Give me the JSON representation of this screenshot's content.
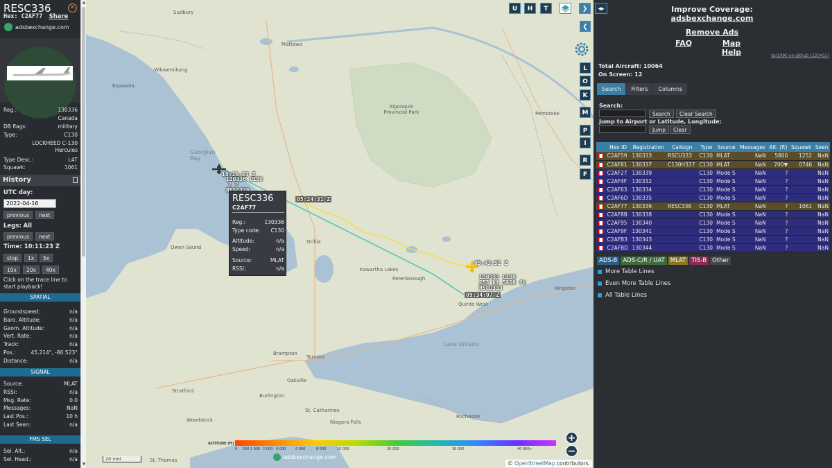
{
  "left": {
    "title": "RESC336",
    "hex_label": "Hex:",
    "hex_value": "C2AF77",
    "share": "Share",
    "logo_text": "adsbexchange.com",
    "reg_label": "Reg.:",
    "reg_value": "130336",
    "country": "Canada",
    "dbflags_label": "DB flags:",
    "dbflags_value": "military",
    "type_label": "Type:",
    "type_value": "C130",
    "type_desc_full": "LOCKHEED C-130",
    "type_desc_full2": "Hercules",
    "typedesc_label": "Type Desc.:",
    "typedesc_value": "L4T",
    "squawk_label": "Squawk:",
    "squawk_value": "1061",
    "history_label": "History",
    "utc_label": "UTC day:",
    "utc_value": "2022-04-16",
    "previous": "previous",
    "next": "next",
    "legs_label": "Legs: All",
    "time_label": "Time: 10:11:23 Z",
    "stop": "stop",
    "x1": "1x",
    "x5": "5x",
    "x10": "10x",
    "x20": "20x",
    "x40": "40x",
    "help_text": "Click on the trace line to start playback!",
    "spatial_label": "SPATIAL",
    "spatial": [
      {
        "k": "Groundspeed:",
        "v": "n/a"
      },
      {
        "k": "Baro. Altitude:",
        "v": "n/a"
      },
      {
        "k": "Geom. Altitude:",
        "v": "n/a"
      },
      {
        "k": "Vert. Rate:",
        "v": "n/a"
      },
      {
        "k": "Track:",
        "v": "n/a"
      },
      {
        "k": "Pos.:",
        "v": "45.214°, -80.523°"
      },
      {
        "k": "Distance:",
        "v": "n/a"
      }
    ],
    "signal_label": "SIGNAL",
    "signal": [
      {
        "k": "Source:",
        "v": "MLAT"
      },
      {
        "k": "RSSI:",
        "v": "n/a"
      },
      {
        "k": "Msg. Rate:",
        "v": "0.0"
      },
      {
        "k": "Messages:",
        "v": "NaN"
      },
      {
        "k": "Last Pos.:",
        "v": "10 h"
      },
      {
        "k": "Last Seen:",
        "v": "n/a"
      }
    ],
    "fms_label": "FMS SEL",
    "fms": [
      {
        "k": "Sel. Alt.:",
        "v": "n/a"
      },
      {
        "k": "Sel. Head.:",
        "v": "n/a"
      }
    ]
  },
  "map": {
    "top_buttons": [
      "U",
      "H",
      "T"
    ],
    "side_buttons": [
      "L",
      "O",
      "K",
      "M",
      "P",
      "I",
      "R",
      "F"
    ],
    "labels": {
      "sudbury": "Sudbury",
      "mattawa": "Mattawa",
      "algonquin": "Algonquin Provincial Park",
      "georgian": "Georgian Bay",
      "pembroke": "Pembroke",
      "owen": "Owen Sound",
      "orillia": "Orillia",
      "kawartha": "Kawartha Lakes",
      "peterborough": "Peterborough",
      "kingston": "Kingston",
      "quinte": "Quinte West",
      "ontario": "Lake Ontario",
      "brampton": "Brampton",
      "toronto": "Toronto",
      "oakville": "Oakville",
      "burlington": "Burlington",
      "stratford": "Stratford",
      "woodstock": "Woodstock",
      "stcath": "St. Catharines",
      "niagara": "Niagara Falls",
      "rochester": "Rochester",
      "stthomas": "St. Thomas",
      "espanola": "Espanola",
      "wawa": "Wikwemikong"
    },
    "trace": {
      "start_time": "10:11:23 Z",
      "start_info1": "130336 C130",
      "start_info2": "?     ?",
      "start_info3": "RESC336",
      "mid_time": "05:24:31 Z",
      "end_time1": "05:43:52 Z",
      "end_info1": "130333 C130",
      "end_info2": "253 kt  5800 ft",
      "end_info3": "RSCU333",
      "end_time2": "09:34:07 Z"
    },
    "popup": {
      "title": "RESC336",
      "hex": "C2AF77",
      "rows": [
        {
          "k": "Reg.:",
          "v": "130336"
        },
        {
          "k": "Type code:",
          "v": "C130"
        },
        {
          "k": "Altitude:",
          "v": "n/a"
        },
        {
          "k": "Speed:",
          "v": "n/a"
        },
        {
          "k": "Source:",
          "v": "MLAT"
        },
        {
          "k": "RSSI:",
          "v": "n/a"
        }
      ]
    },
    "legend_title": "ALTITUDE (ft)",
    "legend_ticks": [
      "0",
      "500",
      "1 000",
      "2 000",
      "4 000",
      "6 000",
      "8 000",
      "10 000",
      "20 000",
      "30 000",
      "40 000+"
    ],
    "scale": "20 nmi",
    "logo": "adsbexchange.com",
    "attribution_prefix": "©",
    "attribution_link": "OpenStreetMap",
    "attribution_suffix": "contributors."
  },
  "right": {
    "improve": "Improve Coverage:",
    "site": "adsbexchange.com",
    "remove_ads": "Remove Ads",
    "faq": "FAQ",
    "map_help": "Map Help",
    "github": "tar1090 on github (220415)",
    "total_aircraft": "Total Aircraft: 10064",
    "on_screen": "On Screen: 12",
    "tabs": [
      "Search",
      "Filters",
      "Columns"
    ],
    "search_label": "Search:",
    "search_btn": "Search",
    "clear_search_btn": "Clear Search",
    "jump_label": "Jump to Airport or Latitude, Longitude:",
    "jump_btn": "Jump",
    "clear_btn": "Clear",
    "columns": [
      "",
      "Hex ID",
      "Registration",
      "Callsign",
      "Type",
      "Source",
      "Messages",
      "Alt. (ft)",
      "Squawk",
      "Seen"
    ],
    "rows": [
      {
        "hex": "C2AF59",
        "reg": "130333",
        "call": "RSCU333",
        "type": "C130",
        "src": "MLAT",
        "msg": "NaN",
        "alt": "5800",
        "sq": "1252",
        "seen": "NaN",
        "cls": "mlat"
      },
      {
        "hex": "C2AF81",
        "reg": "130337",
        "call": "C130H337",
        "type": "C130",
        "src": "MLAT",
        "msg": "NaN",
        "alt": "700▼",
        "sq": "0746",
        "seen": "NaN",
        "cls": "mlat"
      },
      {
        "hex": "C2AF27",
        "reg": "130339",
        "call": "",
        "type": "C130",
        "src": "Mode S",
        "msg": "NaN",
        "alt": "?",
        "sq": "",
        "seen": "NaN",
        "cls": "mode-s"
      },
      {
        "hex": "C2AF4F",
        "reg": "130332",
        "call": "",
        "type": "C130",
        "src": "Mode S",
        "msg": "NaN",
        "alt": "?",
        "sq": "",
        "seen": "NaN",
        "cls": "mode-s"
      },
      {
        "hex": "C2AF63",
        "reg": "130334",
        "call": "",
        "type": "C130",
        "src": "Mode S",
        "msg": "NaN",
        "alt": "?",
        "sq": "",
        "seen": "NaN",
        "cls": "mode-s"
      },
      {
        "hex": "C2AF6D",
        "reg": "130335",
        "call": "",
        "type": "C130",
        "src": "Mode S",
        "msg": "NaN",
        "alt": "?",
        "sq": "",
        "seen": "NaN",
        "cls": "mode-s"
      },
      {
        "hex": "C2AF77",
        "reg": "130336",
        "call": "RESC336",
        "type": "C130",
        "src": "MLAT",
        "msg": "NaN",
        "alt": "?",
        "sq": "1061",
        "seen": "NaN",
        "cls": "mlat"
      },
      {
        "hex": "C2AF8B",
        "reg": "130338",
        "call": "",
        "type": "C130",
        "src": "Mode S",
        "msg": "NaN",
        "alt": "?",
        "sq": "",
        "seen": "NaN",
        "cls": "mode-s"
      },
      {
        "hex": "C2AF95",
        "reg": "130340",
        "call": "",
        "type": "C130",
        "src": "Mode S",
        "msg": "NaN",
        "alt": "?",
        "sq": "",
        "seen": "NaN",
        "cls": "mode-s"
      },
      {
        "hex": "C2AF9F",
        "reg": "130341",
        "call": "",
        "type": "C130",
        "src": "Mode S",
        "msg": "NaN",
        "alt": "?",
        "sq": "",
        "seen": "NaN",
        "cls": "mode-s"
      },
      {
        "hex": "C2AFB3",
        "reg": "130343",
        "call": "",
        "type": "C130",
        "src": "Mode S",
        "msg": "NaN",
        "alt": "?",
        "sq": "",
        "seen": "NaN",
        "cls": "mode-s"
      },
      {
        "hex": "C2AFBD",
        "reg": "130344",
        "call": "",
        "type": "C130",
        "src": "Mode S",
        "msg": "NaN",
        "alt": "?",
        "sq": "",
        "seen": "NaN",
        "cls": "mode-s"
      }
    ],
    "sources": [
      {
        "label": "ADS-B",
        "color": "#2b5f86",
        "text": "#ffffff"
      },
      {
        "label": "ADS-C/R / UAT",
        "color": "#3f6a3a",
        "text": "#ffffff"
      },
      {
        "label": "MLAT",
        "color": "#8a7426",
        "text": "#ffffff"
      },
      {
        "label": "TIS-B",
        "color": "#8a2a55",
        "text": "#ffffff"
      },
      {
        "label": "Other",
        "color": "#444444",
        "text": "#ffffff"
      }
    ],
    "more_lines": "More Table Lines",
    "even_more_lines": "Even More Table Lines",
    "all_lines": "All Table Lines"
  },
  "colors": {
    "accent": "#3b7fa7",
    "mlat_row": "#5a4e2a",
    "modes_row": "#2e2d7d",
    "band": "#1e6b8f"
  }
}
